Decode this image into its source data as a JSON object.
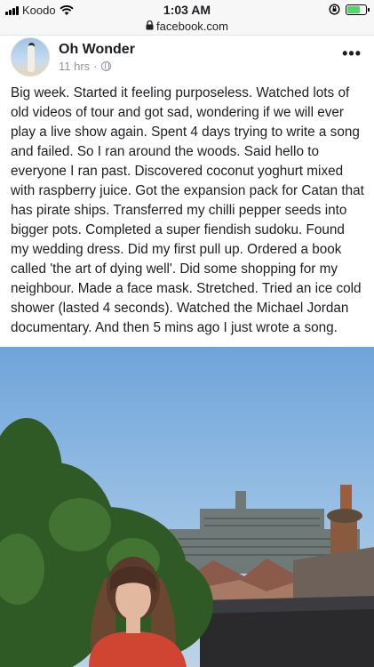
{
  "status_bar": {
    "carrier": "Koodo",
    "time": "1:03 AM",
    "icons": [
      "signal-bars-icon",
      "wifi-icon",
      "orientation-lock-icon",
      "battery-charging-icon"
    ]
  },
  "url_bar": {
    "url": "facebook.com",
    "icon": "lock-icon"
  },
  "post": {
    "author": "Oh Wonder",
    "time": "11 hrs",
    "separator": "·",
    "privacy_icon": "globe-icon",
    "more_icon": "•••",
    "body": "Big week. Started it feeling purposeless. Watched lots of old videos of tour and got sad, wondering if we will ever play a live show again. Spent 4 days trying to write a song and failed. So I ran around the woods. Said hello to everyone I ran past. Discovered coconut yoghurt mixed with raspberry juice. Got the expansion pack for Catan that has pirate ships. Transferred my chilli pepper seeds into bigger pots. Completed a super fiendish sudoku. Found my wedding dress. Did my first pull up. Ordered a book called 'the art of dying well'. Did some shopping for my neighbour. Made a face mask. Stretched. Tried an ice cold shower (lasted 4 seconds). Watched the Michael Jordan documentary. And then 5 mins ago I just wrote a song."
  },
  "colors": {
    "text": "#1c1e21",
    "meta": "#90949c",
    "sky": "#8bb7e1",
    "battery": "#4cd964"
  }
}
